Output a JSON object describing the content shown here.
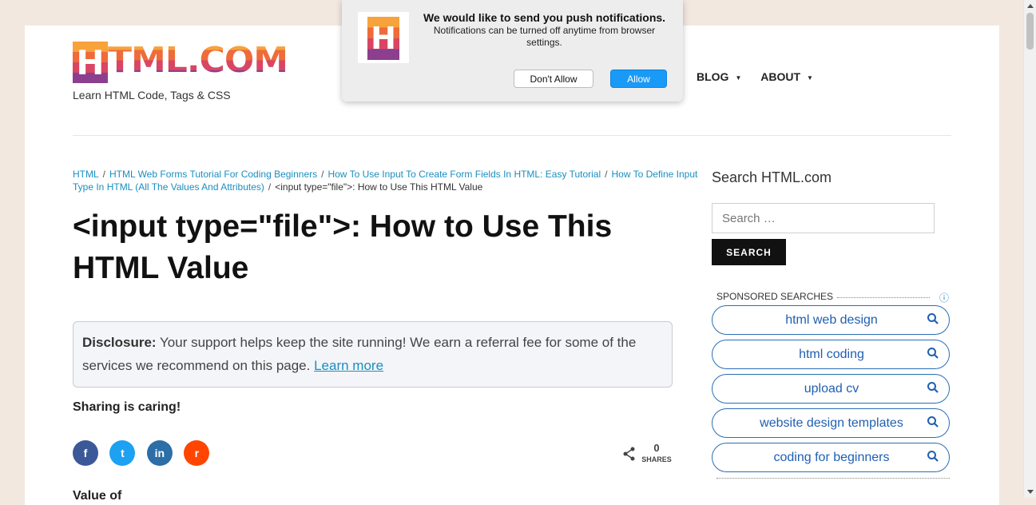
{
  "brand": {
    "logo_text": "TML.COM",
    "logo_letter": "H",
    "tagline": "Learn HTML Code, Tags & CSS"
  },
  "nav": {
    "items": [
      {
        "label": "BLOG",
        "caret": "▼"
      },
      {
        "label": "ABOUT",
        "caret": "▼"
      }
    ]
  },
  "breadcrumb": {
    "links": [
      "HTML",
      "HTML Web Forms Tutorial For Coding Beginners",
      "How To Use Input To Create Form Fields In HTML: Easy Tutorial",
      "How To Define Input Type In HTML (All The Values And Attributes)"
    ],
    "separator": "/",
    "current": "<input type=\"file\">: How to Use This HTML Value"
  },
  "article": {
    "title": "<input type=\"file\">: How to Use This HTML Value",
    "disclosure_label": "Disclosure:",
    "disclosure_text": " Your support helps keep the site running! We earn a referral fee for some of the services we recommend on this page. ",
    "disclosure_link": "Learn more",
    "sharing_label": "Sharing is caring!",
    "share_count": "0",
    "shares_label": "SHARES",
    "next_heading": "Value of"
  },
  "social": [
    {
      "name": "facebook",
      "glyph": "f",
      "color": "#3b5998"
    },
    {
      "name": "twitter",
      "glyph": "t",
      "color": "#1da1f2"
    },
    {
      "name": "linkedin",
      "glyph": "in",
      "color": "#2b6ea8"
    },
    {
      "name": "reddit",
      "glyph": "r",
      "color": "#ff4500"
    }
  ],
  "sidebar": {
    "search_title": "Search HTML.com",
    "search_placeholder": "Search …",
    "search_button": "SEARCH",
    "sponsored_label": "SPONSORED SEARCHES",
    "info_icon": "ⓘ",
    "sponsored_items": [
      "html web design",
      "html coding",
      "upload cv",
      "website design templates",
      "coding for beginners"
    ]
  },
  "push_dialog": {
    "title": "We would like to send you push notifications.",
    "message": "Notifications can be turned off anytime from browser settings.",
    "deny_label": "Don't Allow",
    "allow_label": "Allow",
    "icon_letter": "H"
  },
  "colors": {
    "link": "#1a8fc1",
    "sponsored_text": "#1f5fb2",
    "allow_button": "#1a9af7"
  }
}
